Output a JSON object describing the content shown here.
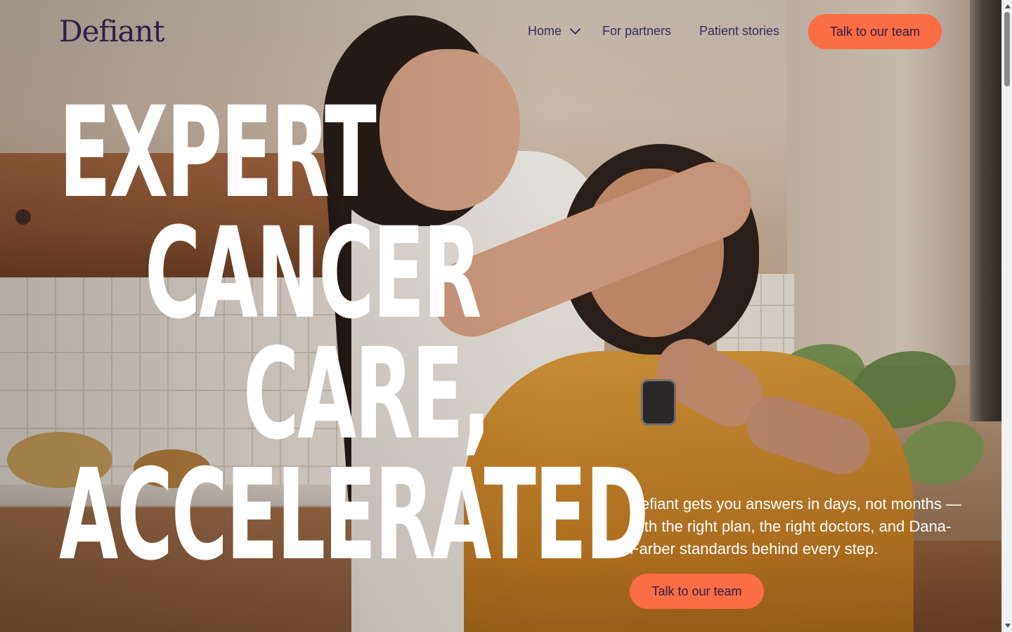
{
  "brand": {
    "logo_text": "Defiant"
  },
  "nav": {
    "home_label": "Home",
    "partners_label": "For partners",
    "stories_label": "Patient stories",
    "cta_label": "Talk to our team"
  },
  "hero": {
    "headline_lines": [
      "EXPERT",
      "CANCER",
      "CARE,",
      "ACCELERATED"
    ],
    "subtext": "Defiant gets you answers in days, not months — with the right plan, the right doctors, and Dana-Farber standards behind every step.",
    "cta_label": "Talk to our team",
    "background_description_icon": "hero-photo"
  },
  "colors": {
    "brand_purple": "#2e1f4a",
    "cta_orange": "#fb6d45",
    "headline_white": "#ffffff"
  },
  "icons": {
    "home_dropdown": "chevron-down-icon",
    "scroll_up": "scroll-up-arrow-icon",
    "scroll_down": "scroll-down-arrow-icon"
  }
}
